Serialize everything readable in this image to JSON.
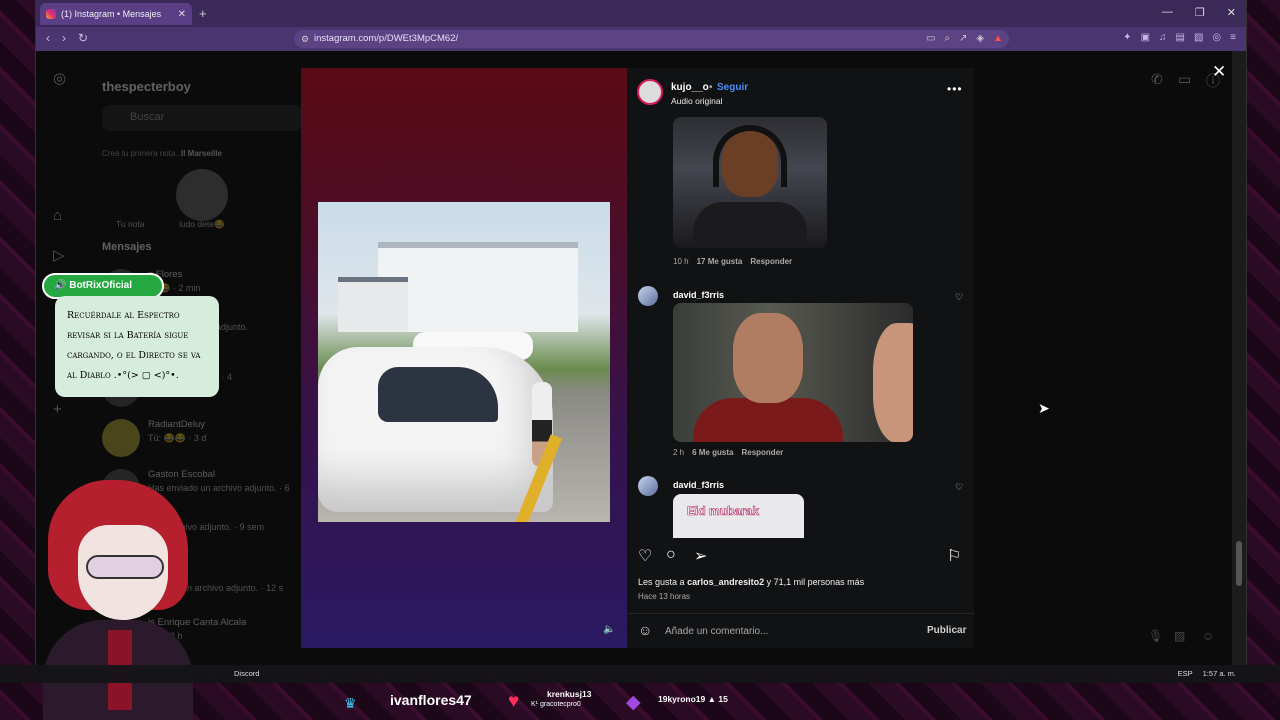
{
  "browser": {
    "tab_title": "(1) Instagram • Mensajes",
    "tab_close": "✕",
    "new_tab": "+",
    "url": "instagram.com/p/DWEt3MpCM62/",
    "win_min": "—",
    "win_max": "❐",
    "win_close": "✕"
  },
  "inbox": {
    "username": "thespecterboy",
    "search_placeholder": "Buscar",
    "note_self": "Crea tu primera nota...",
    "note_friend_name": "Il Marseille",
    "tu_nota": "Tu nota",
    "ludo": "ludo dete😂",
    "messages_header": "Mensajes",
    "conversations": [
      {
        "name": "n Flores",
        "preview": "😂😂 · 2 min"
      },
      {
        "name": "",
        "preview": "viado un archivo adjunto."
      },
      {
        "name": "",
        "preview": "n archivo adjunto. · 4"
      },
      {
        "name": "RadiantDeluy",
        "preview": "Tú: 😂😂 · 3 d"
      },
      {
        "name": "Gaston Escobal",
        "preview": "Has enviado un archivo adjunto. · 6"
      },
      {
        "name": "",
        "preview": "o un archivo adjunto. · 9 sem"
      },
      {
        "name": "Retamal",
        "preview": "enviado un archivo adjunto. · 12 s"
      },
      {
        "name": "is Enrique Canta Alcala",
        "preview": "hace 2 h"
      }
    ]
  },
  "post": {
    "close_icon": "✕",
    "author": "kujo__o",
    "dot": "•",
    "follow": "Seguir",
    "audio": "Audio original",
    "more": "•••",
    "comments": [
      {
        "time": "10 h",
        "likes": "17 Me gusta",
        "reply": "Responder"
      },
      {
        "user": "david_f3rris",
        "time": "2 h",
        "likes": "6 Me gusta",
        "reply": "Responder"
      },
      {
        "user": "david_f3rris",
        "gif_text": "Eid mubarak"
      }
    ],
    "likes_prefix": "Les gusta a",
    "likes_user": "carlos_andresito2",
    "likes_rest": "y 71,1 mil personas más",
    "ago": "Hace 13 horas",
    "comment_placeholder": "Añade un comentario...",
    "publish": "Publicar"
  },
  "overlay": {
    "bot_badge": "🔊 BotRixOficial",
    "bubble": "Recuérdale al Espectro revisar si la Batería sigue cargando, o el Directo se va al Diablo .•°(> ▢ <)°•.",
    "taskbar_app": "Discord",
    "tray_lang": "ESP",
    "tray_time": "1:57 a. m.",
    "stream_user": "ivanflores47",
    "top_donor": "krenkusj13",
    "top_donor_sub": "K¹ gracotecpro0",
    "kyro": "19kyrono19 ▲ 15"
  },
  "colors": {
    "accent_follow": "#4a8df6",
    "browser_bar": "#3b2a57",
    "bot_green": "#24a83f"
  },
  "icons": [
    "instagram-icon",
    "home-icon",
    "reels-icon",
    "plus-icon",
    "phone-icon",
    "video-icon",
    "info-icon",
    "heart-icon",
    "comment-icon",
    "share-icon",
    "bookmark-icon",
    "emoji-icon",
    "mute-icon",
    "mic-icon",
    "image-icon",
    "sticker-icon"
  ]
}
